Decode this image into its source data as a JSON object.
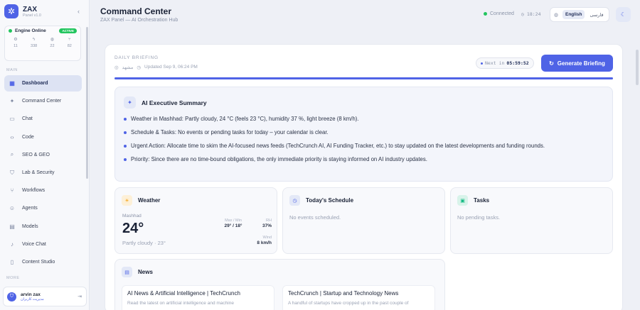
{
  "sidebar": {
    "brand_name": "ZAX",
    "brand_version": "Panel v1.0",
    "engine_label": "Engine Online",
    "engine_badge": "ACTIVE",
    "stats": [
      {
        "icon": "gear-icon",
        "glyph": "⚙",
        "value": "11"
      },
      {
        "icon": "bolt-icon",
        "glyph": "ϟ",
        "value": "338"
      },
      {
        "icon": "globe-icon",
        "glyph": "◍",
        "value": "22"
      },
      {
        "icon": "flow-icon",
        "glyph": "⑂",
        "value": "82"
      }
    ],
    "main_label": "MAIN",
    "items": [
      {
        "label": "Dashboard",
        "icon": "grid-icon",
        "glyph": "▦"
      },
      {
        "label": "Command Center",
        "icon": "sparkle-icon",
        "glyph": "✦"
      },
      {
        "label": "Chat",
        "icon": "chat-icon",
        "glyph": "▭"
      },
      {
        "label": "Code",
        "icon": "code-icon",
        "glyph": "‹›"
      },
      {
        "label": "SEO & GEO",
        "icon": "seo-icon",
        "glyph": "⌕"
      },
      {
        "label": "Lab & Security",
        "icon": "shield-icon",
        "glyph": "⛉"
      },
      {
        "label": "Workflows",
        "icon": "workflow-icon",
        "glyph": "⑂"
      },
      {
        "label": "Agents",
        "icon": "robot-icon",
        "glyph": "☺"
      },
      {
        "label": "Models",
        "icon": "models-icon",
        "glyph": "▤"
      },
      {
        "label": "Voice Chat",
        "icon": "mic-icon",
        "glyph": "♪"
      },
      {
        "label": "Content Studio",
        "icon": "document-icon",
        "glyph": "▯"
      }
    ],
    "more_label": "MORE",
    "user_name": "arvin zax",
    "user_role": "مدیریت کاربران"
  },
  "header": {
    "title": "Command Center",
    "subtitle": "ZAX Panel — AI Orchestration Hub",
    "connection": "Connected",
    "time": "18:24",
    "lang_en": "English",
    "lang_fa": "فارسی"
  },
  "briefing": {
    "label": "DAILY BRIEFING",
    "location": "مشهد",
    "updated": "Updated Sep 9, 06:24 PM",
    "next_label": "Next in",
    "next_value": "05:59:52",
    "generate_label": "Generate Briefing",
    "progress": 1.0
  },
  "summary": {
    "title": "AI Executive Summary",
    "bullets": [
      "Weather in Mashhad: Partly cloudy, 24 °C (feels 23 °C), humidity 37 %, light breeze (8 km/h).",
      "Schedule & Tasks: No events or pending tasks for today – your calendar is clear.",
      "Urgent Action: Allocate time to skim the AI-focused news feeds (TechCrunch AI, AI Funding Tracker, etc.) to stay updated on the latest developments and funding rounds.",
      "Priority: Since there are no time-bound obligations, the only immediate priority is staying informed on AI industry updates."
    ]
  },
  "weather": {
    "title": "Weather",
    "city": "Mashhad",
    "temp": "24°",
    "desc": "Partly cloudy · 23°",
    "maxmin_label": "Max / Min",
    "maxmin_value": "29° / 18°",
    "rh_label": "RH",
    "rh_value": "37%",
    "wind_label": "Wind",
    "wind_value": "8 km/h"
  },
  "schedule": {
    "title": "Today's Schedule",
    "empty": "No events scheduled."
  },
  "tasks": {
    "title": "Tasks",
    "empty": "No pending tasks."
  },
  "news": {
    "title": "News",
    "items": [
      {
        "title": "AI News & Artificial Intelligence | TechCrunch",
        "desc": "Read the latest on artificial intelligence and machine"
      },
      {
        "title": "TechCrunch | Startup and Technology News",
        "desc": "A handful of startups have cropped up in the past couple of"
      }
    ]
  },
  "colors": {
    "accent": "#4f63e6",
    "online": "#22c55e",
    "weather_icon": "#f59e0b",
    "tasks_icon": "#10b981"
  }
}
